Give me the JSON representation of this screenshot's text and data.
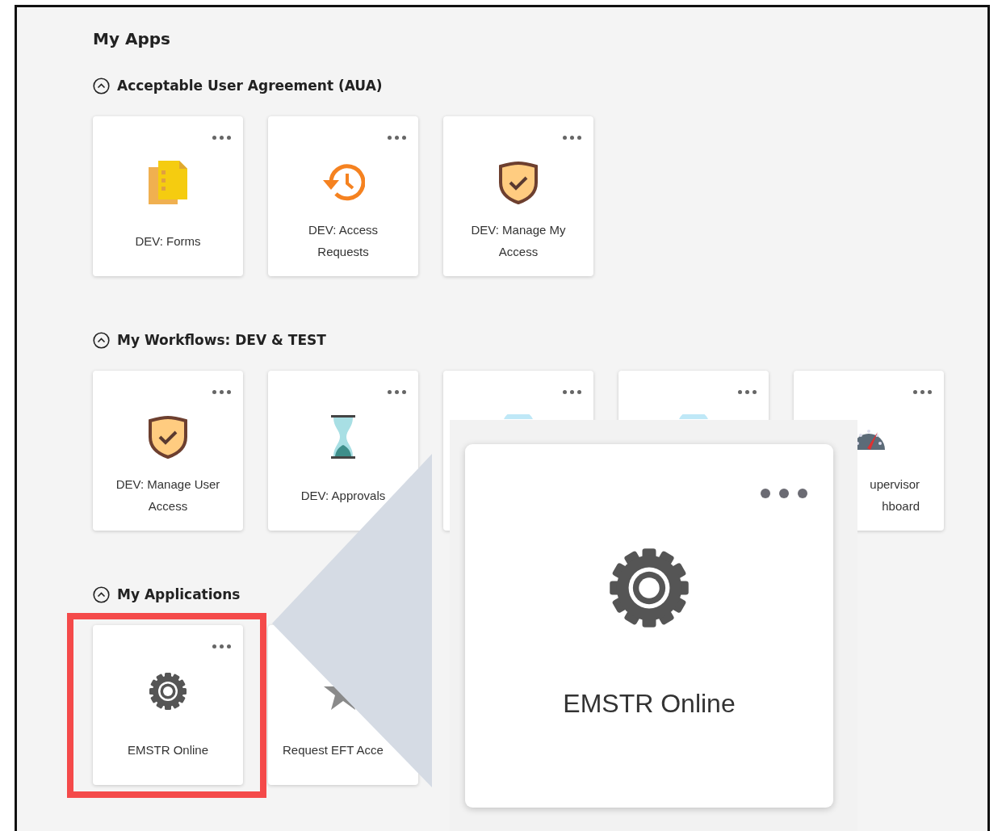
{
  "title": "My Apps",
  "sections": [
    {
      "title": "Acceptable User Agreement (AUA)",
      "expanded": true,
      "tiles": [
        {
          "kind": "forms",
          "label": "DEV: Forms"
        },
        {
          "kind": "history",
          "label": "DEV: Access Requests"
        },
        {
          "kind": "shield",
          "label": "DEV: Manage My Access"
        }
      ]
    },
    {
      "title": "My Workflows: DEV & TEST",
      "expanded": true,
      "tiles": [
        {
          "kind": "shield",
          "label": "DEV: Manage User Access"
        },
        {
          "kind": "hourglass",
          "label": "DEV: Approvals"
        },
        {
          "kind": "hidden"
        },
        {
          "kind": "hidden"
        },
        {
          "kind": "gauge",
          "label": "upervisor hboard"
        }
      ]
    },
    {
      "title": "My Applications",
      "expanded": true,
      "tiles": [
        {
          "kind": "gear",
          "label": "EMSTR Online"
        },
        {
          "kind": "star",
          "label": "Request EFT Acce"
        }
      ]
    }
  ],
  "callout": {
    "label": "EMSTR Online"
  }
}
